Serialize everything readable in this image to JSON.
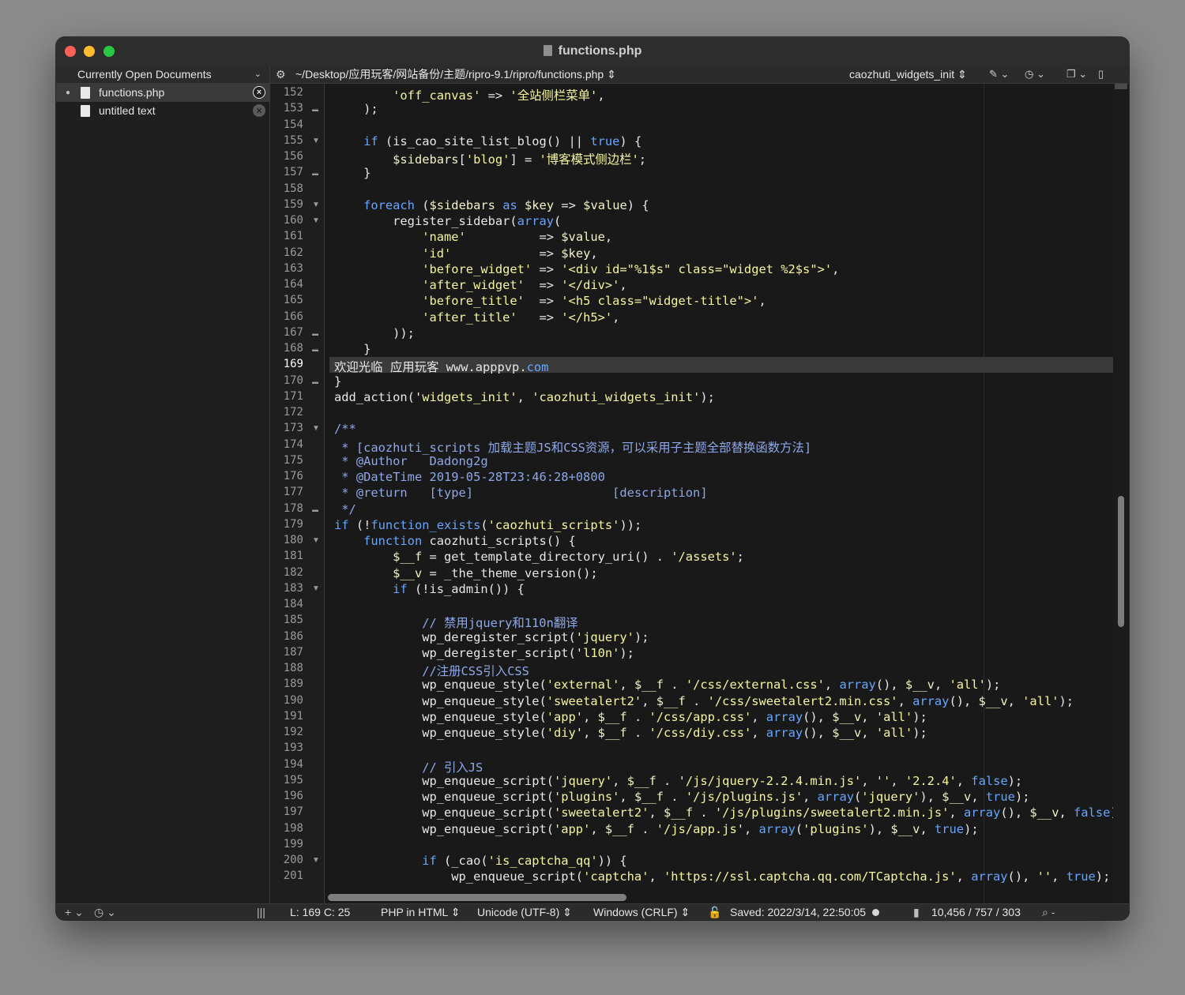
{
  "window": {
    "title": "functions.php"
  },
  "sidebar": {
    "header": "Currently Open Documents",
    "documents": [
      {
        "name": "functions.php",
        "active": true
      },
      {
        "name": "untitled text",
        "active": false
      }
    ]
  },
  "editor": {
    "path": "~/Desktop/应用玩客/网站备份/主题/ripro-9.1/ripro/functions.php",
    "function_popup": "caozhuti_widgets_init",
    "current_line": 169,
    "lines": [
      {
        "n": 152,
        "indent": 8,
        "parts": [
          [
            "s",
            "'off_canvas'"
          ],
          [
            "t",
            " => "
          ],
          [
            "s",
            "'全站侧栏菜单'"
          ],
          [
            "t",
            ","
          ]
        ]
      },
      {
        "n": 153,
        "indent": 4,
        "fold": "end",
        "parts": [
          [
            "t",
            ");"
          ]
        ]
      },
      {
        "n": 154,
        "indent": 0,
        "parts": []
      },
      {
        "n": 155,
        "indent": 4,
        "fold": "start",
        "parts": [
          [
            "k",
            "if"
          ],
          [
            "t",
            " (is_cao_site_list_blog() || "
          ],
          [
            "k",
            "true"
          ],
          [
            "t",
            ") {"
          ]
        ]
      },
      {
        "n": 156,
        "indent": 8,
        "parts": [
          [
            "v",
            "$sidebars"
          ],
          [
            "t",
            "["
          ],
          [
            "s",
            "'blog'"
          ],
          [
            "t",
            "] = "
          ],
          [
            "s",
            "'博客模式侧边栏'"
          ],
          [
            "t",
            ";"
          ]
        ]
      },
      {
        "n": 157,
        "indent": 4,
        "fold": "end",
        "parts": [
          [
            "t",
            "}"
          ]
        ]
      },
      {
        "n": 158,
        "indent": 0,
        "parts": []
      },
      {
        "n": 159,
        "indent": 4,
        "fold": "start",
        "parts": [
          [
            "k",
            "foreach"
          ],
          [
            "t",
            " ("
          ],
          [
            "v",
            "$sidebars"
          ],
          [
            "t",
            " "
          ],
          [
            "k",
            "as"
          ],
          [
            "t",
            " "
          ],
          [
            "v",
            "$key"
          ],
          [
            "t",
            " => "
          ],
          [
            "v",
            "$value"
          ],
          [
            "t",
            ") {"
          ]
        ]
      },
      {
        "n": 160,
        "indent": 8,
        "fold": "start",
        "parts": [
          [
            "t",
            "register_sidebar("
          ],
          [
            "k",
            "array"
          ],
          [
            "t",
            "("
          ]
        ]
      },
      {
        "n": 161,
        "indent": 12,
        "parts": [
          [
            "s",
            "'name'"
          ],
          [
            "t",
            "          => "
          ],
          [
            "v",
            "$value"
          ],
          [
            "t",
            ","
          ]
        ]
      },
      {
        "n": 162,
        "indent": 12,
        "parts": [
          [
            "s",
            "'id'"
          ],
          [
            "t",
            "            => "
          ],
          [
            "v",
            "$key"
          ],
          [
            "t",
            ","
          ]
        ]
      },
      {
        "n": 163,
        "indent": 12,
        "parts": [
          [
            "s",
            "'before_widget'"
          ],
          [
            "t",
            " => "
          ],
          [
            "s",
            "'<div id=\"%1$s\" class=\"widget %2$s\">'"
          ],
          [
            "t",
            ","
          ]
        ]
      },
      {
        "n": 164,
        "indent": 12,
        "parts": [
          [
            "s",
            "'after_widget'"
          ],
          [
            "t",
            "  => "
          ],
          [
            "s",
            "'</div>'"
          ],
          [
            "t",
            ","
          ]
        ]
      },
      {
        "n": 165,
        "indent": 12,
        "parts": [
          [
            "s",
            "'before_title'"
          ],
          [
            "t",
            "  => "
          ],
          [
            "s",
            "'<h5 class=\"widget-title\">'"
          ],
          [
            "t",
            ","
          ]
        ]
      },
      {
        "n": 166,
        "indent": 12,
        "parts": [
          [
            "s",
            "'after_title'"
          ],
          [
            "t",
            "   => "
          ],
          [
            "s",
            "'</h5>'"
          ],
          [
            "t",
            ","
          ]
        ]
      },
      {
        "n": 167,
        "indent": 8,
        "fold": "end",
        "parts": [
          [
            "t",
            "));"
          ]
        ]
      },
      {
        "n": 168,
        "indent": 4,
        "fold": "end",
        "parts": [
          [
            "t",
            "}"
          ]
        ]
      },
      {
        "n": 169,
        "indent": 0,
        "parts": [
          [
            "t",
            "欢迎光临 应用玩客 www.apppvp."
          ],
          [
            "k",
            "com"
          ]
        ]
      },
      {
        "n": 170,
        "indent": 0,
        "fold": "end",
        "parts": [
          [
            "t",
            "}"
          ]
        ]
      },
      {
        "n": 171,
        "indent": 0,
        "parts": [
          [
            "t",
            "add_action("
          ],
          [
            "s",
            "'widgets_init'"
          ],
          [
            "t",
            ", "
          ],
          [
            "s",
            "'caozhuti_widgets_init'"
          ],
          [
            "t",
            ");"
          ]
        ]
      },
      {
        "n": 172,
        "indent": 0,
        "parts": []
      },
      {
        "n": 173,
        "indent": 0,
        "fold": "start",
        "parts": [
          [
            "c",
            "/**"
          ]
        ]
      },
      {
        "n": 174,
        "indent": 1,
        "parts": [
          [
            "c",
            "* [caozhuti_scripts 加载主题JS和CSS资源，可以采用子主题全部替换函数方法]"
          ]
        ]
      },
      {
        "n": 175,
        "indent": 1,
        "parts": [
          [
            "c",
            "* @Author   Dadong2g"
          ]
        ]
      },
      {
        "n": 176,
        "indent": 1,
        "parts": [
          [
            "c",
            "* @DateTime 2019-05-28T23:46:28+0800"
          ]
        ]
      },
      {
        "n": 177,
        "indent": 1,
        "parts": [
          [
            "c",
            "* @return   [type]                   [description]"
          ]
        ]
      },
      {
        "n": 178,
        "indent": 1,
        "fold": "end",
        "parts": [
          [
            "c",
            "*/"
          ]
        ]
      },
      {
        "n": 179,
        "indent": 0,
        "parts": [
          [
            "k",
            "if"
          ],
          [
            "t",
            " (!"
          ],
          [
            "k",
            "function_exists"
          ],
          [
            "t",
            "("
          ],
          [
            "s",
            "'caozhuti_scripts'"
          ],
          [
            "t",
            "));"
          ]
        ]
      },
      {
        "n": 180,
        "indent": 4,
        "fold": "start",
        "parts": [
          [
            "k",
            "function"
          ],
          [
            "t",
            " caozhuti_scripts() {"
          ]
        ]
      },
      {
        "n": 181,
        "indent": 8,
        "parts": [
          [
            "v",
            "$__f"
          ],
          [
            "t",
            " = get_template_directory_uri() . "
          ],
          [
            "s",
            "'/assets'"
          ],
          [
            "t",
            ";"
          ]
        ]
      },
      {
        "n": 182,
        "indent": 8,
        "parts": [
          [
            "v",
            "$__v"
          ],
          [
            "t",
            " = _the_theme_version();"
          ]
        ]
      },
      {
        "n": 183,
        "indent": 8,
        "fold": "start",
        "parts": [
          [
            "k",
            "if"
          ],
          [
            "t",
            " (!is_admin()) {"
          ]
        ]
      },
      {
        "n": 184,
        "indent": 0,
        "parts": []
      },
      {
        "n": 185,
        "indent": 12,
        "parts": [
          [
            "c",
            "// 禁用jquery和110n翻译"
          ]
        ]
      },
      {
        "n": 186,
        "indent": 12,
        "parts": [
          [
            "t",
            "wp_deregister_script("
          ],
          [
            "s",
            "'jquery'"
          ],
          [
            "t",
            ");"
          ]
        ]
      },
      {
        "n": 187,
        "indent": 12,
        "parts": [
          [
            "t",
            "wp_deregister_script("
          ],
          [
            "s",
            "'l10n'"
          ],
          [
            "t",
            ");"
          ]
        ]
      },
      {
        "n": 188,
        "indent": 12,
        "parts": [
          [
            "c",
            "//注册CSS引入CSS"
          ]
        ]
      },
      {
        "n": 189,
        "indent": 12,
        "parts": [
          [
            "t",
            "wp_enqueue_style("
          ],
          [
            "s",
            "'external'"
          ],
          [
            "t",
            ", "
          ],
          [
            "v",
            "$__f"
          ],
          [
            "t",
            " . "
          ],
          [
            "s",
            "'/css/external.css'"
          ],
          [
            "t",
            ", "
          ],
          [
            "k",
            "array"
          ],
          [
            "t",
            "(), "
          ],
          [
            "v",
            "$__v"
          ],
          [
            "t",
            ", "
          ],
          [
            "s",
            "'all'"
          ],
          [
            "t",
            ");"
          ]
        ]
      },
      {
        "n": 190,
        "indent": 12,
        "parts": [
          [
            "t",
            "wp_enqueue_style("
          ],
          [
            "s",
            "'sweetalert2'"
          ],
          [
            "t",
            ", "
          ],
          [
            "v",
            "$__f"
          ],
          [
            "t",
            " . "
          ],
          [
            "s",
            "'/css/sweetalert2.min.css'"
          ],
          [
            "t",
            ", "
          ],
          [
            "k",
            "array"
          ],
          [
            "t",
            "(), "
          ],
          [
            "v",
            "$__v"
          ],
          [
            "t",
            ", "
          ],
          [
            "s",
            "'all'"
          ],
          [
            "t",
            ");"
          ]
        ]
      },
      {
        "n": 191,
        "indent": 12,
        "parts": [
          [
            "t",
            "wp_enqueue_style("
          ],
          [
            "s",
            "'app'"
          ],
          [
            "t",
            ", "
          ],
          [
            "v",
            "$__f"
          ],
          [
            "t",
            " . "
          ],
          [
            "s",
            "'/css/app.css'"
          ],
          [
            "t",
            ", "
          ],
          [
            "k",
            "array"
          ],
          [
            "t",
            "(), "
          ],
          [
            "v",
            "$__v"
          ],
          [
            "t",
            ", "
          ],
          [
            "s",
            "'all'"
          ],
          [
            "t",
            ");"
          ]
        ]
      },
      {
        "n": 192,
        "indent": 12,
        "parts": [
          [
            "t",
            "wp_enqueue_style("
          ],
          [
            "s",
            "'diy'"
          ],
          [
            "t",
            ", "
          ],
          [
            "v",
            "$__f"
          ],
          [
            "t",
            " . "
          ],
          [
            "s",
            "'/css/diy.css'"
          ],
          [
            "t",
            ", "
          ],
          [
            "k",
            "array"
          ],
          [
            "t",
            "(), "
          ],
          [
            "v",
            "$__v"
          ],
          [
            "t",
            ", "
          ],
          [
            "s",
            "'all'"
          ],
          [
            "t",
            ");"
          ]
        ]
      },
      {
        "n": 193,
        "indent": 0,
        "parts": []
      },
      {
        "n": 194,
        "indent": 12,
        "parts": [
          [
            "c",
            "// 引入JS"
          ]
        ]
      },
      {
        "n": 195,
        "indent": 12,
        "parts": [
          [
            "t",
            "wp_enqueue_script("
          ],
          [
            "s",
            "'jquery'"
          ],
          [
            "t",
            ", "
          ],
          [
            "v",
            "$__f"
          ],
          [
            "t",
            " . "
          ],
          [
            "s",
            "'/js/jquery-2.2.4.min.js'"
          ],
          [
            "t",
            ", "
          ],
          [
            "s",
            "''"
          ],
          [
            "t",
            ", "
          ],
          [
            "s",
            "'2.2.4'"
          ],
          [
            "t",
            ", "
          ],
          [
            "k",
            "false"
          ],
          [
            "t",
            ");"
          ]
        ]
      },
      {
        "n": 196,
        "indent": 12,
        "parts": [
          [
            "t",
            "wp_enqueue_script("
          ],
          [
            "s",
            "'plugins'"
          ],
          [
            "t",
            ", "
          ],
          [
            "v",
            "$__f"
          ],
          [
            "t",
            " . "
          ],
          [
            "s",
            "'/js/plugins.js'"
          ],
          [
            "t",
            ", "
          ],
          [
            "k",
            "array"
          ],
          [
            "t",
            "("
          ],
          [
            "s",
            "'jquery'"
          ],
          [
            "t",
            "), "
          ],
          [
            "v",
            "$__v"
          ],
          [
            "t",
            ", "
          ],
          [
            "k",
            "true"
          ],
          [
            "t",
            ");"
          ]
        ]
      },
      {
        "n": 197,
        "indent": 12,
        "parts": [
          [
            "t",
            "wp_enqueue_script("
          ],
          [
            "s",
            "'sweetalert2'"
          ],
          [
            "t",
            ", "
          ],
          [
            "v",
            "$__f"
          ],
          [
            "t",
            " . "
          ],
          [
            "s",
            "'/js/plugins/sweetalert2.min.js'"
          ],
          [
            "t",
            ", "
          ],
          [
            "k",
            "array"
          ],
          [
            "t",
            "(), "
          ],
          [
            "v",
            "$__v"
          ],
          [
            "t",
            ", "
          ],
          [
            "k",
            "false"
          ],
          [
            "t",
            ");"
          ]
        ]
      },
      {
        "n": 198,
        "indent": 12,
        "parts": [
          [
            "t",
            "wp_enqueue_script("
          ],
          [
            "s",
            "'app'"
          ],
          [
            "t",
            ", "
          ],
          [
            "v",
            "$__f"
          ],
          [
            "t",
            " . "
          ],
          [
            "s",
            "'/js/app.js'"
          ],
          [
            "t",
            ", "
          ],
          [
            "k",
            "array"
          ],
          [
            "t",
            "("
          ],
          [
            "s",
            "'plugins'"
          ],
          [
            "t",
            "), "
          ],
          [
            "v",
            "$__v"
          ],
          [
            "t",
            ", "
          ],
          [
            "k",
            "true"
          ],
          [
            "t",
            ");"
          ]
        ]
      },
      {
        "n": 199,
        "indent": 0,
        "parts": []
      },
      {
        "n": 200,
        "indent": 12,
        "fold": "start",
        "parts": [
          [
            "k",
            "if"
          ],
          [
            "t",
            " (_cao("
          ],
          [
            "s",
            "'is_captcha_qq'"
          ],
          [
            "t",
            ")) {"
          ]
        ]
      },
      {
        "n": 201,
        "indent": 16,
        "parts": [
          [
            "t",
            "wp_enqueue_script("
          ],
          [
            "s",
            "'captcha'"
          ],
          [
            "t",
            ", "
          ],
          [
            "s",
            "'https://ssl.captcha.qq.com/TCaptcha.js'"
          ],
          [
            "t",
            ", "
          ],
          [
            "k",
            "array"
          ],
          [
            "t",
            "(), "
          ],
          [
            "s",
            "''"
          ],
          [
            "t",
            ", "
          ],
          [
            "k",
            "true"
          ],
          [
            "t",
            ");"
          ]
        ]
      }
    ]
  },
  "status": {
    "position": "L: 169 C: 25",
    "language": "PHP in HTML",
    "encoding": "Unicode (UTF-8)",
    "line_endings": "Windows (CRLF)",
    "saved": "Saved: 2022/3/14, 22:50:05",
    "counts": "10,456 / 757 / 303",
    "zoom_minus": "-",
    "add_label": "+",
    "clock_label": "◷"
  },
  "colors": {
    "string": "#f5f5a0",
    "keyword": "#66a6ff",
    "comment": "#8ea8e8",
    "current_line": "#3a3a3a"
  }
}
